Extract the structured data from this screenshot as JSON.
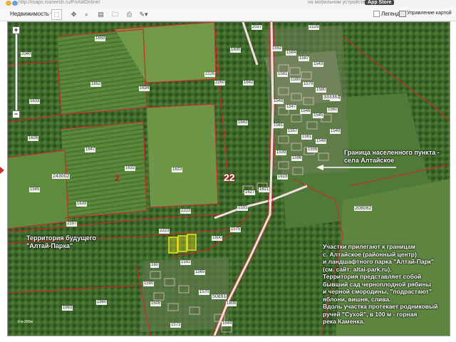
{
  "browser": {
    "url": "http://maps.rosreestr.ru/PortalOnline/",
    "mobile_text": "на мобильном устройстве",
    "store_text": "App Store"
  },
  "toolbar": {
    "property_label": "Недвижимость ▾",
    "legend_label": "Легенда",
    "control_label": "Управление картой"
  },
  "map": {
    "parcels": [
      {
        "id": "p1",
        "text": "2040"
      },
      {
        "id": "p2",
        "text": "1650"
      },
      {
        "id": "p3",
        "text": "1652"
      },
      {
        "id": "p4",
        "text": "1634"
      },
      {
        "id": "p5",
        "text": "1633"
      },
      {
        "id": "p6",
        "text": "1626"
      },
      {
        "id": "p7",
        "text": "1647"
      },
      {
        "id": "p8",
        "text": "1632"
      },
      {
        "id": "p9",
        "text": "1623"
      },
      {
        "id": "p10",
        "text": "1600"
      },
      {
        "id": "p11",
        "text": "1643"
      },
      {
        "id": "p12",
        "text": "2226"
      },
      {
        "id": "p13",
        "text": "2260"
      },
      {
        "id": "p14",
        "text": "1642"
      },
      {
        "id": "p15",
        "text": "2027"
      },
      {
        "id": "p16",
        "text": "2229"
      },
      {
        "id": "p17",
        "text": "1639"
      },
      {
        "id": "p18",
        "text": "1585"
      },
      {
        "id": "p19",
        "text": "2197"
      },
      {
        "id": "p20",
        "text": "1600"
      },
      {
        "id": "p21",
        "text": "2223"
      },
      {
        "id": "p22",
        "text": "2223"
      },
      {
        "id": "p23",
        "text": "160"
      },
      {
        "id": "p24",
        "text": "1592"
      },
      {
        "id": "p25",
        "text": "1590"
      },
      {
        "id": "p26",
        "text": "1606"
      },
      {
        "id": "p27",
        "text": "1863"
      },
      {
        "id": "p28",
        "text": "1860"
      },
      {
        "id": "p29",
        "text": "1573"
      },
      {
        "id": "p30",
        "text": "1544"
      },
      {
        "id": "p31",
        "text": "1552"
      },
      {
        "id": "p32",
        "text": "1584"
      },
      {
        "id": "p33",
        "text": "1587"
      },
      {
        "id": "p34",
        "text": "1543"
      },
      {
        "id": "p35",
        "text": "1581"
      },
      {
        "id": "p36",
        "text": "1580"
      },
      {
        "id": "p37",
        "text": "1579"
      },
      {
        "id": "p38",
        "text": "1580"
      },
      {
        "id": "p39",
        "text": "1544"
      },
      {
        "id": "p40",
        "text": "1548"
      },
      {
        "id": "p41",
        "text": "1547"
      },
      {
        "id": "p42",
        "text": "1546"
      },
      {
        "id": "p43",
        "text": "1545"
      },
      {
        "id": "p44",
        "text": "1560"
      },
      {
        "id": "p45",
        "text": "1561"
      },
      {
        "id": "p46",
        "text": "1557"
      },
      {
        "id": "p47",
        "text": "1561"
      },
      {
        "id": "p48",
        "text": "1548"
      },
      {
        "id": "p49",
        "text": "1549"
      },
      {
        "id": "p50",
        "text": "1539"
      },
      {
        "id": "p51",
        "text": "1596"
      },
      {
        "id": "p52",
        "text": "1556"
      },
      {
        "id": "p53",
        "text": "1619"
      },
      {
        "id": "p54",
        "text": "1627"
      },
      {
        "id": "p55",
        "text": "1621"
      },
      {
        "id": "p56",
        "text": "1593"
      },
      {
        "id": "p57",
        "text": "1575"
      },
      {
        "id": "p58",
        "text": "1565"
      },
      {
        "id": "p59",
        "text": "1570"
      },
      {
        "id": "p60",
        "text": "1608"
      }
    ],
    "big_labels": {
      "l1": "243002",
      "l2": "208082",
      "l3": "33336",
      "l4": "50891",
      "l22": "22",
      "l2b": "2"
    },
    "annotation_border": "Граница населенного пункта -\nсела Алтайское",
    "annotation_park": "Территория будущего\n\"Алтай-Парка\"",
    "annotation_info": "Участки прилегают к границам\nс. Алтайское (районный центр)\nи ландшафтного парка \"Алтай-Парк\"\n(см. сайт: altai-park.ru).\nТерритория представляет собой\nбывший сад черноплодной рябины\nи черной смородины, \"подрастают\"\nяблони, вишня, слива.\nВдоль участка протекает родниковый\nручей \"Сухой\", в 100 м - горная\nрека Каменка.",
    "scale_label": "0 м          200м",
    "colors": {
      "boundary": "#c92b2b",
      "road": "#fbe8ea",
      "highlight": "#f0e020"
    }
  }
}
